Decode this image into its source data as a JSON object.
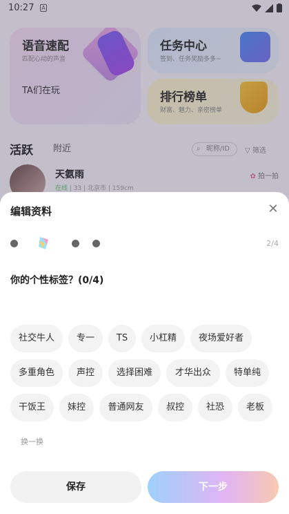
{
  "status_bar": {
    "time": "10:27",
    "notification_glyph": "A"
  },
  "cards": {
    "voice": {
      "title": "语音速配",
      "subtitle": "匹配心动的声音",
      "footer": "TA们在玩"
    },
    "task": {
      "title": "任务中心",
      "subtitle": "签到、任务奖励多多~"
    },
    "rank": {
      "title": "排行榜单",
      "subtitle": "财富、魅力、亲密榜单"
    }
  },
  "feed": {
    "tab_active": "活跃",
    "tab_nearby": "附近",
    "search_placeholder": "昵称/ID",
    "filter_label": "筛选"
  },
  "user": {
    "name": "天氨雨",
    "status": "在线",
    "age": "33",
    "city": "北京市",
    "height": "159cm",
    "action": "拍一拍"
  },
  "sheet": {
    "title": "编辑资料",
    "page": "2/4",
    "question": "你的个性标签？(0/4)",
    "tags": [
      {
        "label": "社交牛人"
      },
      {
        "label": "专一"
      },
      {
        "label": "TS"
      },
      {
        "label": "小杠精"
      },
      {
        "label": "夜场爱好者"
      },
      {
        "label": "多重角色"
      },
      {
        "label": "声控"
      },
      {
        "label": "选择困难"
      },
      {
        "label": "才华出众"
      },
      {
        "label": "特单纯"
      },
      {
        "label": "干饭王"
      },
      {
        "label": "妹控"
      },
      {
        "label": "普通网友"
      },
      {
        "label": "叔控"
      },
      {
        "label": "社恐"
      },
      {
        "label": "老板"
      }
    ],
    "swap_label": "换一换",
    "save_label": "保存",
    "next_label": "下一步"
  },
  "colors": {
    "overlay": "#46465a",
    "next_gradient_start": "#9fd0fb",
    "next_gradient_end": "#f8c9b0"
  }
}
